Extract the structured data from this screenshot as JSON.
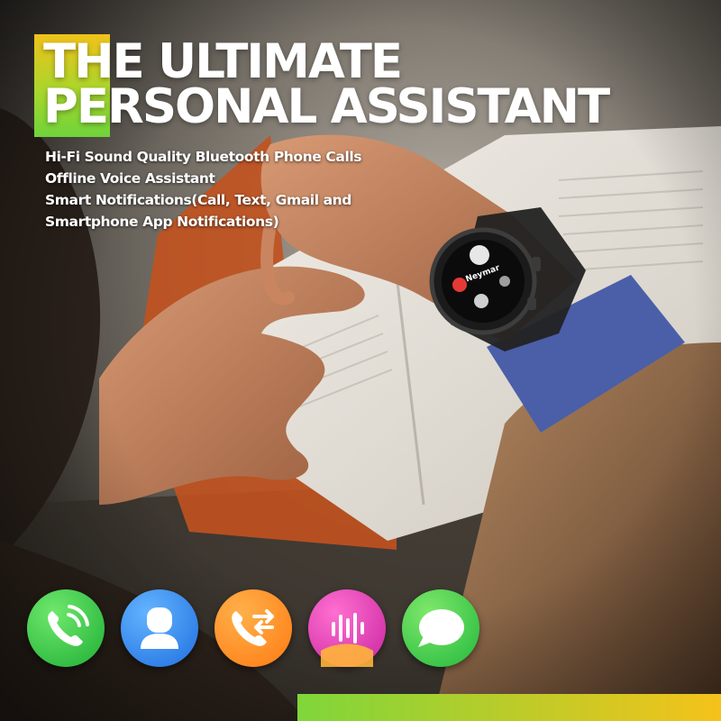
{
  "headline": {
    "line1": "THE ULTIMATE",
    "line2": "PERSONAL ASSISTANT"
  },
  "features": [
    "Hi-Fi Sound Quality Bluetooth Phone Calls",
    "Offline Voice Assistant",
    "Smart Notifications(Call, Text, Gmail and",
    "Smartphone App Notifications)"
  ],
  "watch_screen": {
    "caller_name": "Neymar"
  },
  "colors": {
    "accent_yellow": "#f0c21a",
    "accent_green": "#6fd43a",
    "sleeve_blue": "#4a5fa8"
  },
  "icons": [
    {
      "name": "phone-call-icon",
      "color": "#2ec44a"
    },
    {
      "name": "contacts-icon",
      "color": "#2f86f0"
    },
    {
      "name": "call-transfer-icon",
      "color": "#ff8a1a"
    },
    {
      "name": "voice-assistant-icon",
      "color": "#e83aa8"
    },
    {
      "name": "message-icon",
      "color": "#36c94c"
    }
  ]
}
